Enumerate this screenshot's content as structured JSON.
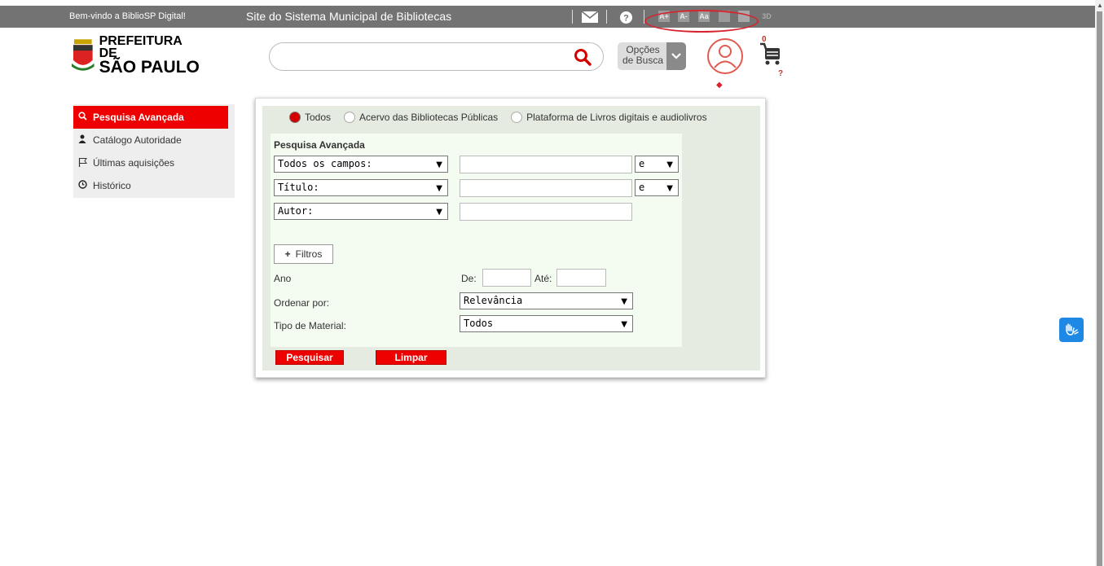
{
  "topbar": {
    "welcome": "Bem-vindo a BiblioSP Digital!",
    "site_title": "Site do Sistema Municipal de Bibliotecas",
    "accessibility": {
      "a_plus": "A+",
      "a_minus": "A-",
      "aa": "Aa"
    }
  },
  "logo": {
    "line1": "PREFEITURA DE",
    "line2": "SÃO PAULO"
  },
  "search": {
    "placeholder": "",
    "options_label_1": "Opções",
    "options_label_2": "de Busca"
  },
  "cart": {
    "count": "0",
    "note": "?"
  },
  "user": {
    "dot": "◆"
  },
  "sidebar": {
    "items": [
      {
        "label": "Pesquisa Avançada",
        "icon": "search-icon",
        "active": true
      },
      {
        "label": "Catálogo Autoridade",
        "icon": "person-icon",
        "active": false
      },
      {
        "label": "Últimas aquisições",
        "icon": "flag-icon",
        "active": false
      },
      {
        "label": "Histórico",
        "icon": "clock-icon",
        "active": false
      }
    ]
  },
  "scope": {
    "options": [
      "Todos",
      "Acervo das Bibliotecas Públicas",
      "Plataforma de Livros digitais e audiolivros"
    ],
    "selected": "Todos"
  },
  "form": {
    "heading": "Pesquisa Avançada",
    "rows": [
      {
        "field": "Todos os campos:",
        "value": "",
        "operator": "e"
      },
      {
        "field": "Título:",
        "value": "",
        "operator": "e"
      },
      {
        "field": "Autor:",
        "value": ""
      }
    ],
    "filters_button": "Filtros",
    "year_label": "Ano",
    "year_from_label": "De:",
    "year_to_label": "Até:",
    "order_label": "Ordenar por:",
    "order_value": "Relevância",
    "material_label": "Tipo de Material:",
    "material_value": "Todos",
    "search_button": "Pesquisar",
    "clear_button": "Limpar"
  },
  "colors": {
    "accent": "#e00000",
    "topbar": "#737373",
    "form_bg": "#f4fbf1"
  }
}
